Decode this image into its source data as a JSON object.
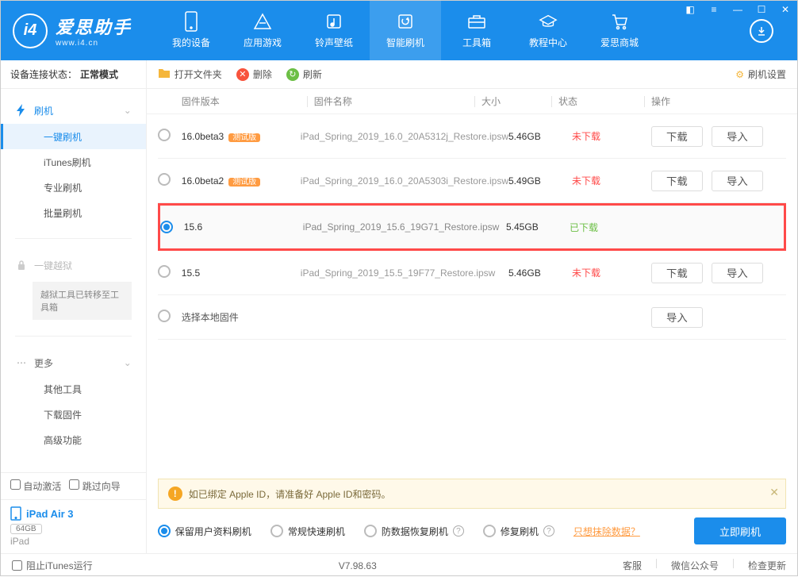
{
  "brand": {
    "title": "爱思助手",
    "url": "www.i4.cn"
  },
  "navs": [
    "我的设备",
    "应用游戏",
    "铃声壁纸",
    "智能刷机",
    "工具箱",
    "教程中心",
    "爱思商城"
  ],
  "conn": {
    "label": "设备连接状态：",
    "status": "正常模式"
  },
  "sidebar": {
    "flash": "刷机",
    "items": [
      "一键刷机",
      "iTunes刷机",
      "专业刷机",
      "批量刷机"
    ],
    "jailbreak": "一键越狱",
    "jailbreak_note": "越狱工具已转移至工具箱",
    "more": "更多",
    "more_items": [
      "其他工具",
      "下载固件",
      "高级功能"
    ]
  },
  "auto": {
    "activate": "自动激活",
    "skip": "跳过向导"
  },
  "device": {
    "name": "iPad Air 3",
    "storage": "64GB",
    "type": "iPad"
  },
  "toolbar": {
    "open": "打开文件夹",
    "delete": "删除",
    "refresh": "刷新",
    "settings": "刷机设置"
  },
  "table": {
    "version": "固件版本",
    "name": "固件名称",
    "size": "大小",
    "status": "状态",
    "ops": "操作"
  },
  "beta_tag": "测试版",
  "fw": [
    {
      "v": "16.0beta3",
      "beta": true,
      "name": "iPad_Spring_2019_16.0_20A5312j_Restore.ipsw",
      "size": "5.46GB",
      "status": "未下载",
      "dl": false,
      "sel": false,
      "download": true,
      "import": true
    },
    {
      "v": "16.0beta2",
      "beta": true,
      "name": "iPad_Spring_2019_16.0_20A5303i_Restore.ipsw",
      "size": "5.49GB",
      "status": "未下载",
      "dl": false,
      "sel": false,
      "download": true,
      "import": true
    },
    {
      "v": "15.6",
      "beta": false,
      "name": "iPad_Spring_2019_15.6_19G71_Restore.ipsw",
      "size": "5.45GB",
      "status": "已下载",
      "dl": true,
      "sel": true,
      "download": false,
      "import": false
    },
    {
      "v": "15.5",
      "beta": false,
      "name": "iPad_Spring_2019_15.5_19F77_Restore.ipsw",
      "size": "5.46GB",
      "status": "未下载",
      "dl": false,
      "sel": false,
      "download": true,
      "import": true
    }
  ],
  "select_local": "选择本地固件",
  "btn": {
    "download": "下载",
    "import": "导入"
  },
  "warning": "如已绑定 Apple ID，请准备好 Apple ID和密码。",
  "opts": [
    "保留用户资料刷机",
    "常规快速刷机",
    "防数据恢复刷机",
    "修复刷机"
  ],
  "erase_link": "只想抹除数据？",
  "flash_now": "立即刷机",
  "footer": {
    "block": "阻止iTunes运行",
    "version": "V7.98.63",
    "links": [
      "客服",
      "微信公众号",
      "检查更新"
    ]
  }
}
